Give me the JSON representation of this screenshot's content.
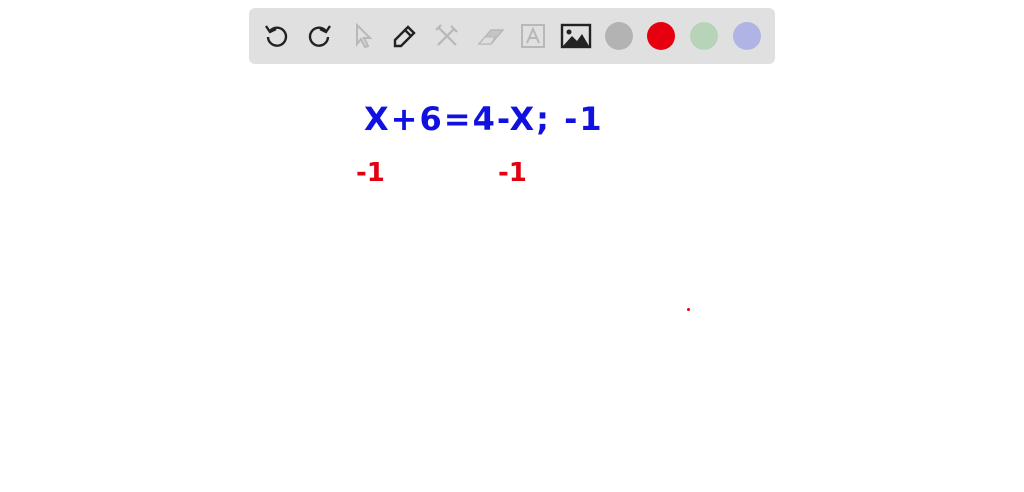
{
  "toolbar": {
    "tools": [
      "undo-icon",
      "redo-icon",
      "select-icon",
      "pen-icon",
      "tools-icon",
      "eraser-icon",
      "text-icon",
      "image-icon"
    ],
    "colors": {
      "gray": "#b3b3b3",
      "red": "#e6000f",
      "green": "#b8d4b8",
      "blue": "#b0b4e4"
    }
  },
  "canvas": {
    "equation": "X+6=4-X; -1",
    "left_step": "-1",
    "right_step": "-1",
    "ink_blue": "#1010e0",
    "ink_red": "#e00010"
  }
}
